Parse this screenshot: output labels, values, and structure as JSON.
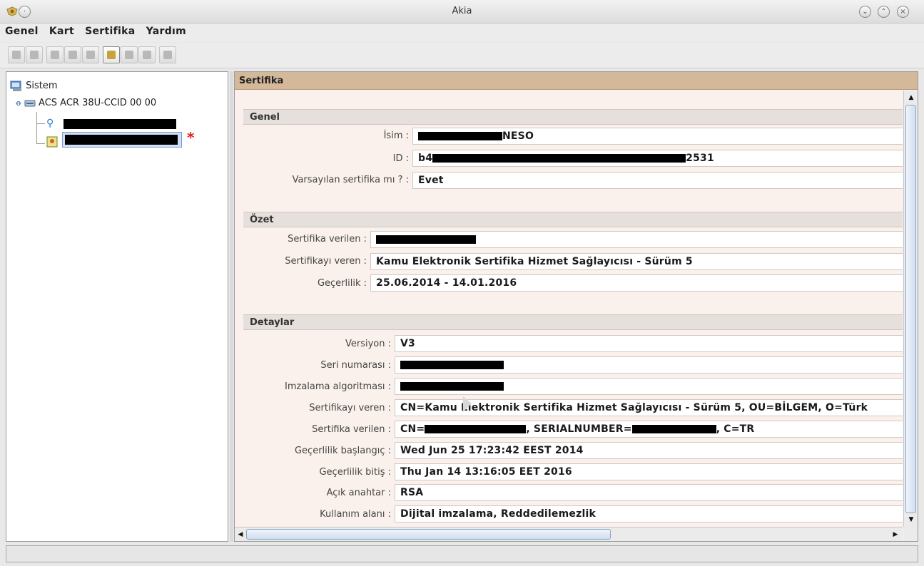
{
  "window": {
    "title": "Akia"
  },
  "menu": [
    "Genel",
    "Kart",
    "Sertifika",
    "Yardım"
  ],
  "tree": {
    "root": "Sistem",
    "reader": "ACS ACR 38U-CCID 00 00"
  },
  "panel": {
    "title": "Sertifika",
    "sections": {
      "genel": {
        "title": "Genel",
        "rows": [
          {
            "label": "İsim :",
            "value": "NESO"
          },
          {
            "label": "ID :",
            "value_prefix": "b4",
            "value": "2531"
          },
          {
            "label": "Varsayılan sertifika mı ? :",
            "value": "Evet"
          }
        ]
      },
      "ozet": {
        "title": "Özet",
        "rows": [
          {
            "label": "Sertifika verilen :",
            "value": ""
          },
          {
            "label": "Sertifikayı veren :",
            "value": "Kamu Elektronik Sertifika Hizmet Sağlayıcısı - Sürüm 5"
          },
          {
            "label": "Geçerlilik :",
            "value": "25.06.2014 - 14.01.2016"
          }
        ]
      },
      "detaylar": {
        "title": "Detaylar",
        "rows": [
          {
            "label": "Versiyon :",
            "value": "V3"
          },
          {
            "label": "Seri numarası :",
            "value": ""
          },
          {
            "label": "Imzalama algoritması :",
            "value": ""
          },
          {
            "label": "Sertifikayı veren :",
            "value": "CN=Kamu Elektronik Sertifika Hizmet Sağlayıcısı - Sürüm 5, OU=BİLGEM, O=Türk"
          },
          {
            "label": "Sertifika verilen :",
            "value_prefix": "CN=",
            "value_mid": ", SERIALNUMBER=",
            "value_suffix": ", C=TR"
          },
          {
            "label": "Geçerlilik başlangıç :",
            "value": "Wed Jun 25 17:23:42 EEST 2014"
          },
          {
            "label": "Geçerlilik bitiş :",
            "value": "Thu Jan 14 13:16:05 EET 2016"
          },
          {
            "label": "Açık anahtar :",
            "value": "RSA"
          },
          {
            "label": "Kullanım alanı :",
            "value": "Dijital imzalama, Reddedilemezlik"
          }
        ]
      }
    }
  },
  "colors": {
    "header": "#d4b89a",
    "content_bg": "#fbf1ec",
    "section_bg": "#e6e0dc",
    "star": "#e02020"
  }
}
